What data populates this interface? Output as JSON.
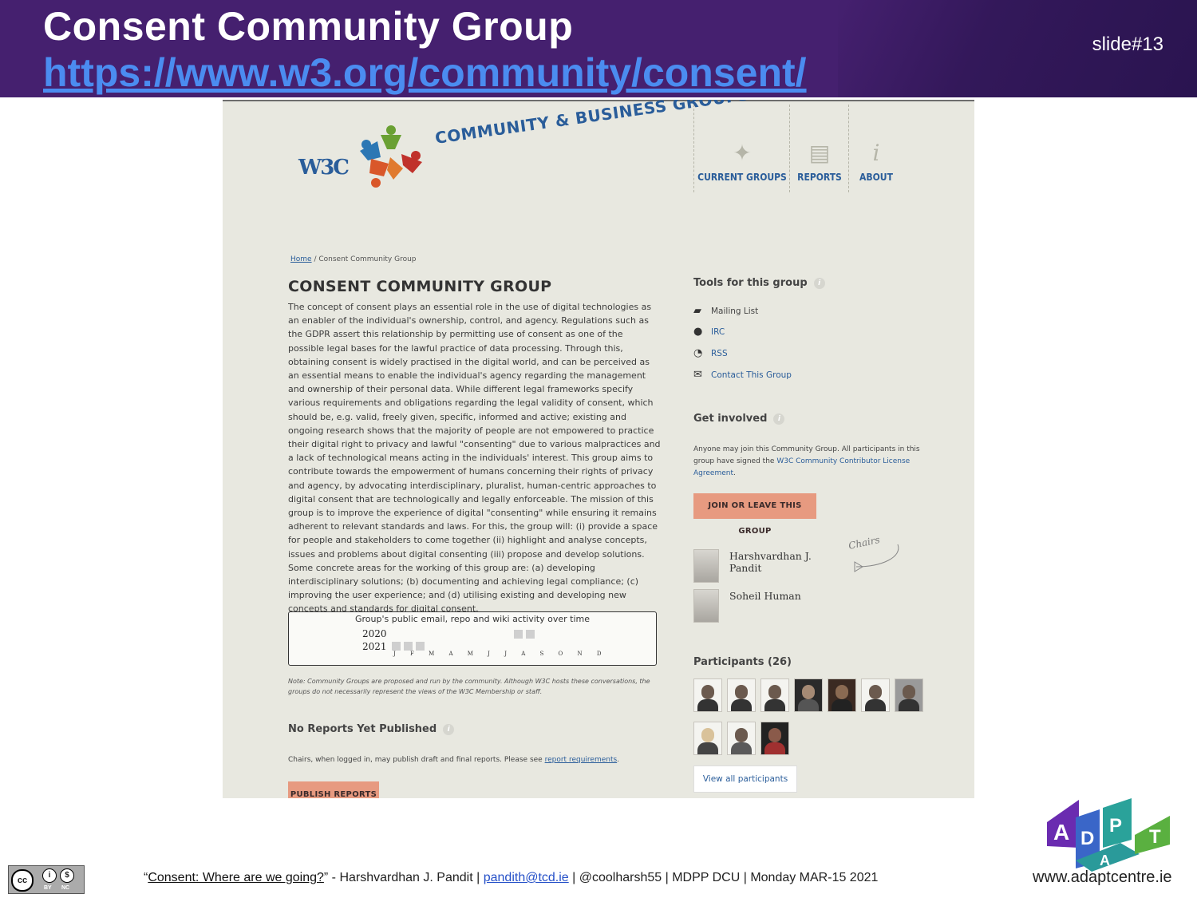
{
  "slide": {
    "title": "Consent Community Group",
    "url": "https://www.w3.org/community/consent/",
    "number": "slide#13"
  },
  "site": {
    "w3c_logo": "W3C",
    "banner": "COMMUNITY & BUSINESS GROUPS",
    "nav": [
      {
        "label": "CURRENT GROUPS",
        "icon": "person-icon"
      },
      {
        "label": "REPORTS",
        "icon": "document-icon"
      },
      {
        "label": "ABOUT",
        "icon": "info-icon"
      }
    ]
  },
  "breadcrumb": {
    "home": "Home",
    "current": "/ Consent Community Group"
  },
  "main": {
    "heading": "CONSENT COMMUNITY GROUP",
    "description": "The concept of consent plays an essential role in the use of digital technologies as an enabler of the individual's ownership, control, and agency. Regulations such as the GDPR assert this relationship by permitting use of consent as one of the possible legal bases for the lawful practice of data processing. Through this, obtaining consent is widely practised in the digital world, and can be perceived as an essential means to enable the individual's agency regarding the management and ownership of their personal data. While different legal frameworks specify various requirements and obligations regarding the legal validity of consent, which should be, e.g. valid, freely given, specific, informed and active; existing and ongoing research shows that the majority of people are not empowered to practice their digital right to privacy and lawful \"consenting\" due to various malpractices and a lack of technological means acting in the individuals' interest. This group aims to contribute towards the empowerment of humans concerning their rights of privacy and agency, by advocating interdisciplinary, pluralist, human-centric approaches to digital consent that are technologically and legally enforceable. The mission of this group is to improve the experience of digital \"consenting\" while ensuring it remains adherent to relevant standards and laws. For this, the group will: (i) provide a space for people and stakeholders to come together (ii) highlight and analyse concepts, issues and problems about digital consenting (iii) propose and develop solutions. Some concrete areas for the working of this group are: (a) developing interdisciplinary solutions; (b) documenting and achieving legal compliance; (c) improving the user experience; and (d) utilising existing and developing new concepts and standards for digital consent.",
    "activity": {
      "title": "Group's public email, repo and wiki activity over time",
      "years": [
        "2020",
        "2021"
      ],
      "months": "J F M A M J J A S O N D"
    },
    "note": "Note: Community Groups are proposed and run by the community. Although W3C hosts these conversations, the groups do not necessarily represent the views of the W3C Membership or staff.",
    "reports_heading": "No Reports Yet Published",
    "reports_text": "Chairs, when logged in, may publish draft and final reports. Please see",
    "reports_link": "report requirements",
    "publish_button": "PUBLISH REPORTS"
  },
  "sidebar": {
    "tools_heading": "Tools for this group",
    "tools": [
      {
        "label": "Mailing List",
        "icon": "mail-list-icon"
      },
      {
        "label": "IRC",
        "icon": "chat-bubble-icon"
      },
      {
        "label": "RSS",
        "icon": "rss-icon"
      },
      {
        "label": "Contact This Group",
        "icon": "envelope-icon"
      }
    ],
    "involved_heading": "Get involved",
    "involved_text": "Anyone may join this Community Group. All participants in this group have signed the",
    "involved_link": "W3C Community Contributor License Agreement",
    "join_button": "JOIN OR LEAVE THIS GROUP",
    "chairs_note": "Chairs",
    "chairs": [
      "Harshvardhan J. Pandit",
      "Soheil Human"
    ],
    "participants_heading": "Participants (26)",
    "view_all": "View all participants"
  },
  "footer": {
    "cc_badge": "cc",
    "cc_by": "BY",
    "cc_nc": "NC",
    "quote_open": "“",
    "talk_title": "Consent: Where are we going?",
    "byline": "” - Harshvardhan J. Pandit |",
    "email": "pandith@tcd.ie",
    "rest": "| @coolharsh55 | MDPP DCU | Monday MAR-15 2021",
    "adapt_url": "www.adaptcentre.ie"
  },
  "colors": {
    "header_bg": "#45206f",
    "url_blue": "#4b8cf0",
    "w3c_blue": "#2a5d9a",
    "button_orange": "#e79a80",
    "page_bg": "#e8e8e0"
  }
}
